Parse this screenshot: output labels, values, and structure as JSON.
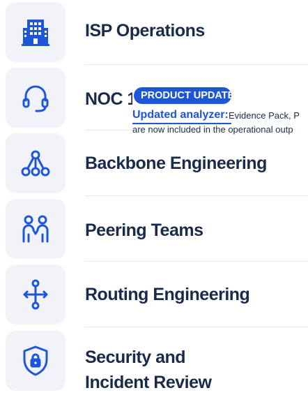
{
  "items": [
    {
      "label": "ISP Operations",
      "icon": "building-icon"
    },
    {
      "label": "NOC 1",
      "icon": "headset-icon"
    },
    {
      "label": "Backbone Engineering",
      "icon": "network-nodes-icon"
    },
    {
      "label": "Peering Teams",
      "icon": "people-handshake-icon"
    },
    {
      "label": "Routing Engineering",
      "icon": "routing-arrows-icon"
    },
    {
      "label": "Security and\nIncident Review",
      "icon": "shield-lock-icon"
    }
  ],
  "update": {
    "badge": "PRODUCT UPDATE",
    "title": "Updated analyzer:",
    "text_line1": "Evidence Pack, P",
    "text_line2": "are now included in the operational outp"
  },
  "colors": {
    "accent": "#1d56d8",
    "text": "#1a2b4a",
    "tile": "#f1f3f8"
  }
}
